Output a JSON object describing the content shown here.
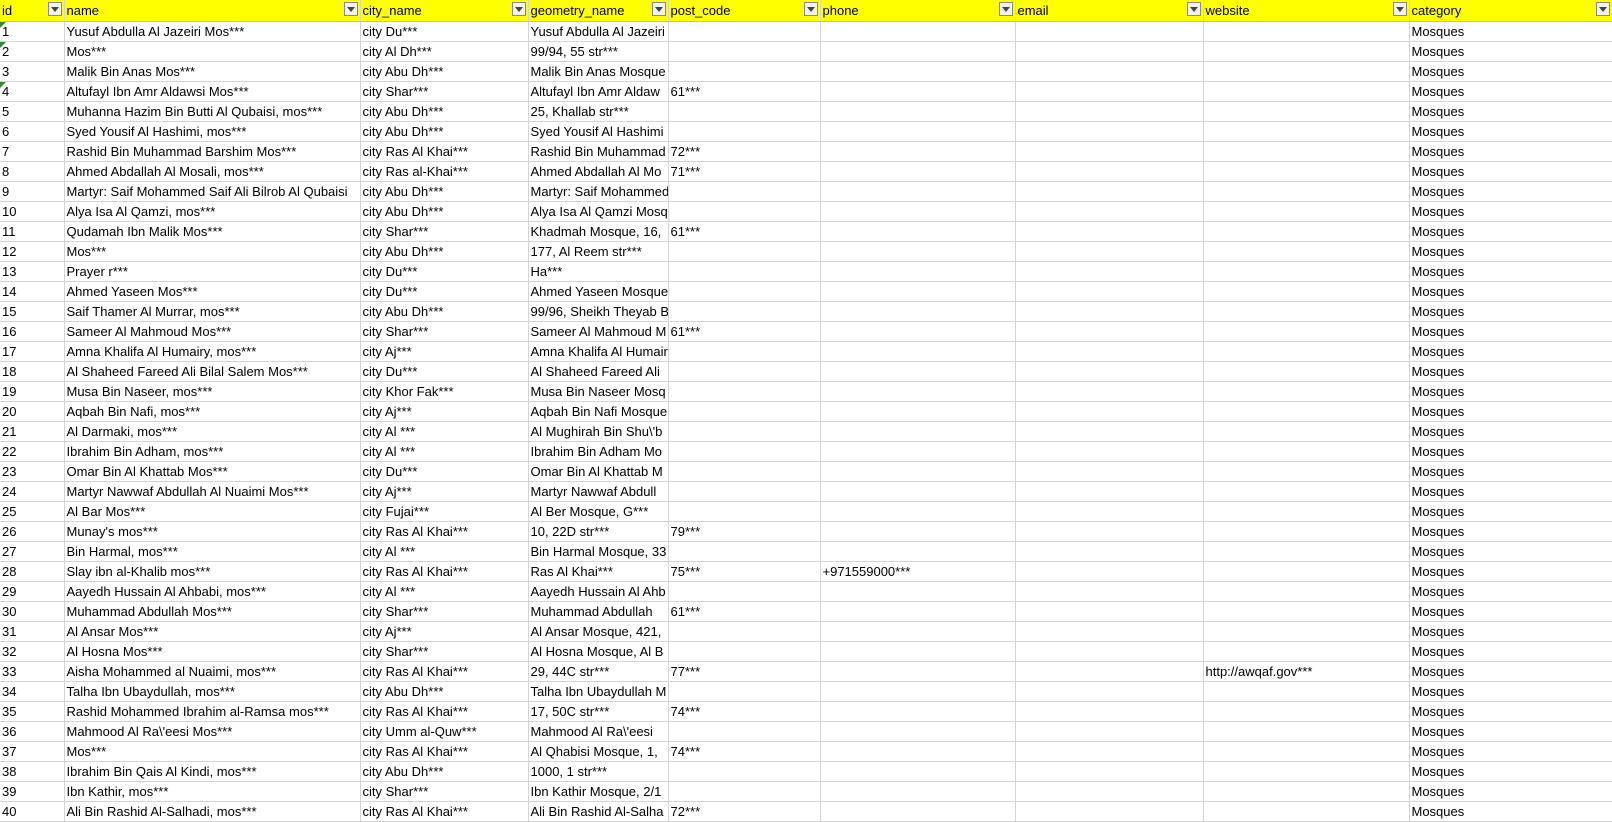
{
  "columns": [
    "id",
    "name",
    "city_name",
    "geometry_name",
    "post_code",
    "phone",
    "email",
    "website",
    "category"
  ],
  "rows": [
    [
      "1",
      "Yusuf Abdulla Al Jazeiri Mos***",
      "city Du***",
      "Yusuf Abdulla Al Jazeiri",
      "",
      "",
      "",
      "",
      "Mosques"
    ],
    [
      "2",
      "Mos***",
      "city Al Dh***",
      "99/94, 55 str***",
      "",
      "",
      "",
      "",
      "Mosques"
    ],
    [
      "3",
      "Malik Bin Anas Mos***",
      "city Abu Dh***",
      "Malik Bin Anas Mosque",
      "",
      "",
      "",
      "",
      "Mosques"
    ],
    [
      "4",
      "Altufayl Ibn Amr Aldawsi Mos***",
      "city Shar***",
      "Altufayl Ibn Amr Aldaw",
      "61***",
      "",
      "",
      "",
      "Mosques"
    ],
    [
      "5",
      "Muhanna Hazim Bin Butti Al Qubaisi, mos***",
      "city Abu Dh***",
      "25, Khallab str***",
      "",
      "",
      "",
      "",
      "Mosques"
    ],
    [
      "6",
      "Syed Yousif Al Hashimi, mos***",
      "city Abu Dh***",
      "Syed Yousif Al Hashimi",
      "",
      "",
      "",
      "",
      "Mosques"
    ],
    [
      "7",
      "Rashid Bin Muhammad Barshim Mos***",
      "city Ras Al Khai***",
      "Rashid Bin Muhammad",
      "72***",
      "",
      "",
      "",
      "Mosques"
    ],
    [
      "8",
      "Ahmed Abdallah Al Mosali, mos***",
      "city Ras al-Khai***",
      "Ahmed Abdallah Al Mo",
      "71***",
      "",
      "",
      "",
      "Mosques"
    ],
    [
      "9",
      "Martyr: Saif Mohammed Saif Ali Bilrob Al Qubaisi",
      "city Abu Dh***",
      "Martyr: Saif Mohammed",
      "",
      "",
      "",
      "",
      "Mosques"
    ],
    [
      "10",
      "Alya Isa Al Qamzi, mos***",
      "city Abu Dh***",
      "Alya Isa Al Qamzi Mosq",
      "",
      "",
      "",
      "",
      "Mosques"
    ],
    [
      "11",
      "Qudamah Ibn Malik Mos***",
      "city Shar***",
      "Khadmah Mosque, 16,",
      "61***",
      "",
      "",
      "",
      "Mosques"
    ],
    [
      "12",
      "Mos***",
      "city Abu Dh***",
      "177, Al Reem str***",
      "",
      "",
      "",
      "",
      "Mosques"
    ],
    [
      "13",
      "Prayer r***",
      "city Du***",
      "Ha***",
      "",
      "",
      "",
      "",
      "Mosques"
    ],
    [
      "14",
      "Ahmed Yaseen Mos***",
      "city Du***",
      "Ahmed Yaseen Mosque",
      "",
      "",
      "",
      "",
      "Mosques"
    ],
    [
      "15",
      "Saif Thamer Al Murrar, mos***",
      "city Abu Dh***",
      "99/96, Sheikh Theyab B",
      "",
      "",
      "",
      "",
      "Mosques"
    ],
    [
      "16",
      "Sameer Al Mahmoud Mos***",
      "city Shar***",
      "Sameer Al Mahmoud M",
      "61***",
      "",
      "",
      "",
      "Mosques"
    ],
    [
      "17",
      "Amna Khalifa Al Humairy, mos***",
      "city Aj***",
      "Amna Khalifa Al Humair",
      "",
      "",
      "",
      "",
      "Mosques"
    ],
    [
      "18",
      "Al Shaheed Fareed Ali Bilal Salem Mos***",
      "city Du***",
      "Al Shaheed Fareed Ali",
      "",
      "",
      "",
      "",
      "Mosques"
    ],
    [
      "19",
      "Musa Bin Naseer, mos***",
      "city Khor Fak***",
      "Musa Bin Naseer Mosq",
      "",
      "",
      "",
      "",
      "Mosques"
    ],
    [
      "20",
      "Aqbah Bin Nafi, mos***",
      "city Aj***",
      "Aqbah Bin Nafi Mosque",
      "",
      "",
      "",
      "",
      "Mosques"
    ],
    [
      "21",
      "Al Darmaki, mos***",
      "city Al ***",
      "Al Mughirah Bin Shu\\'b",
      "",
      "",
      "",
      "",
      "Mosques"
    ],
    [
      "22",
      "Ibrahim Bin Adham, mos***",
      "city Al ***",
      "Ibrahim Bin Adham Mo",
      "",
      "",
      "",
      "",
      "Mosques"
    ],
    [
      "23",
      "Omar Bin Al Khattab Mos***",
      "city Du***",
      "Omar Bin Al Khattab M",
      "",
      "",
      "",
      "",
      "Mosques"
    ],
    [
      "24",
      "Martyr Nawwaf Abdullah Al Nuaimi Mos***",
      "city Aj***",
      "Martyr Nawwaf Abdull",
      "",
      "",
      "",
      "",
      "Mosques"
    ],
    [
      "25",
      "Al Bar Mos***",
      "city Fujai***",
      "Al Ber Mosque, G***",
      "",
      "",
      "",
      "",
      "Mosques"
    ],
    [
      "26",
      "Munay's mos***",
      "city Ras Al Khai***",
      "10, 22D str***",
      "79***",
      "",
      "",
      "",
      "Mosques"
    ],
    [
      "27",
      "Bin Harmal, mos***",
      "city Al ***",
      "Bin Harmal Mosque, 33",
      "",
      "",
      "",
      "",
      "Mosques"
    ],
    [
      "28",
      "Slay ibn al-Khalib mos***",
      "city Ras Al Khai***",
      "Ras Al Khai***",
      "75***",
      "+971559000***",
      "",
      "",
      "Mosques"
    ],
    [
      "29",
      "Aayedh Hussain Al Ahbabi, mos***",
      "city Al ***",
      "Aayedh Hussain Al Ahb",
      "",
      "",
      "",
      "",
      "Mosques"
    ],
    [
      "30",
      "Muhammad Abdullah Mos***",
      "city Shar***",
      "Muhammad Abdullah",
      "61***",
      "",
      "",
      "",
      "Mosques"
    ],
    [
      "31",
      "Al Ansar Mos***",
      "city Aj***",
      "Al Ansar Mosque, 421,",
      "",
      "",
      "",
      "",
      "Mosques"
    ],
    [
      "32",
      "Al Hosna Mos***",
      "city Shar***",
      "Al Hosna Mosque, Al B",
      "",
      "",
      "",
      "",
      "Mosques"
    ],
    [
      "33",
      "Aisha Mohammed al Nuaimi, mos***",
      "city Ras Al Khai***",
      "29, 44C str***",
      "77***",
      "",
      "",
      "http://awqaf.gov***",
      "Mosques"
    ],
    [
      "34",
      "Talha Ibn Ubaydullah, mos***",
      "city Abu Dh***",
      "Talha Ibn Ubaydullah M",
      "",
      "",
      "",
      "",
      "Mosques"
    ],
    [
      "35",
      "Rashid Mohammed Ibrahim al-Ramsa mos***",
      "city Ras Al Khai***",
      "17, 50C str***",
      "74***",
      "",
      "",
      "",
      "Mosques"
    ],
    [
      "36",
      "Mahmood Al Ra\\'eesi Mos***",
      "city Umm al-Quw***",
      "Mahmood Al Ra\\'eesi",
      "",
      "",
      "",
      "",
      "Mosques"
    ],
    [
      "37",
      "Mos***",
      "city Ras Al Khai***",
      "Al Qhabisi Mosque, 1,",
      "74***",
      "",
      "",
      "",
      "Mosques"
    ],
    [
      "38",
      "Ibrahim Bin Qais Al Kindi, mos***",
      "city Abu Dh***",
      "1000, 1 str***",
      "",
      "",
      "",
      "",
      "Mosques"
    ],
    [
      "39",
      "Ibn Kathir, mos***",
      "city Shar***",
      "Ibn Kathir Mosque, 2/1",
      "",
      "",
      "",
      "",
      "Mosques"
    ],
    [
      "40",
      "Ali Bin Rashid Al-Salhadi, mos***",
      "city Ras Al Khai***",
      "Ali Bin Rashid Al-Salha",
      "72***",
      "",
      "",
      "",
      "Mosques"
    ]
  ],
  "error_marks_on_rows": [
    "1",
    "2",
    "4"
  ],
  "colors": {
    "header_bg": "#ffff00",
    "grid_line": "#d4d4d4",
    "error_mark": "#2e8b2e"
  },
  "icons": {
    "filter": "chevron-down-icon"
  }
}
